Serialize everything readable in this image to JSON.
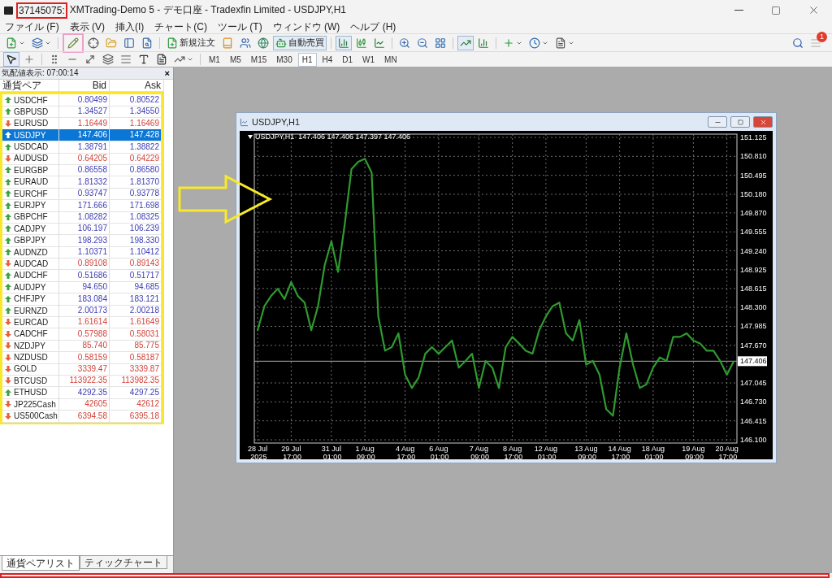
{
  "window": {
    "account": "37145075:",
    "title": "XMTrading-Demo 5 - デモ口座 - Tradexfin Limited - USDJPY,H1"
  },
  "menu": [
    "ファイル (F)",
    "表示 (V)",
    "挿入(I)",
    "チャート(C)",
    "ツール (T)",
    "ウィンドウ (W)",
    "ヘルプ (H)"
  ],
  "toolbar": {
    "order_button": "新規注文",
    "autotrade_button": "自動売買",
    "notification_count": "1"
  },
  "timeframes": [
    {
      "label": "M1",
      "selected": false
    },
    {
      "label": "M5",
      "selected": false
    },
    {
      "label": "M15",
      "selected": false
    },
    {
      "label": "M30",
      "selected": false
    },
    {
      "label": "H1",
      "selected": true
    },
    {
      "label": "H4",
      "selected": false
    },
    {
      "label": "D1",
      "selected": false
    },
    {
      "label": "W1",
      "selected": false
    },
    {
      "label": "MN",
      "selected": false
    }
  ],
  "market_watch": {
    "title": "気配値表示: 07:00:14",
    "close": "×",
    "columns": [
      "通貨ペア",
      "Bid",
      "Ask"
    ],
    "rows": [
      {
        "symbol": "USDCHF",
        "bid": "0.80499",
        "ask": "0.80522",
        "rising": true,
        "selected": false
      },
      {
        "symbol": "GBPUSD",
        "bid": "1.34527",
        "ask": "1.34550",
        "rising": true,
        "selected": false
      },
      {
        "symbol": "EURUSD",
        "bid": "1.16449",
        "ask": "1.16469",
        "rising": false,
        "selected": false
      },
      {
        "symbol": "USDJPY",
        "bid": "147.406",
        "ask": "147.428",
        "rising": true,
        "selected": true
      },
      {
        "symbol": "USDCAD",
        "bid": "1.38791",
        "ask": "1.38822",
        "rising": true,
        "selected": false
      },
      {
        "symbol": "AUDUSD",
        "bid": "0.64205",
        "ask": "0.64229",
        "rising": false,
        "selected": false
      },
      {
        "symbol": "EURGBP",
        "bid": "0.86558",
        "ask": "0.86580",
        "rising": true,
        "selected": false
      },
      {
        "symbol": "EURAUD",
        "bid": "1.81332",
        "ask": "1.81370",
        "rising": true,
        "selected": false
      },
      {
        "symbol": "EURCHF",
        "bid": "0.93747",
        "ask": "0.93778",
        "rising": true,
        "selected": false
      },
      {
        "symbol": "EURJPY",
        "bid": "171.666",
        "ask": "171.698",
        "rising": true,
        "selected": false
      },
      {
        "symbol": "GBPCHF",
        "bid": "1.08282",
        "ask": "1.08325",
        "rising": true,
        "selected": false
      },
      {
        "symbol": "CADJPY",
        "bid": "106.197",
        "ask": "106.239",
        "rising": true,
        "selected": false
      },
      {
        "symbol": "GBPJPY",
        "bid": "198.293",
        "ask": "198.330",
        "rising": true,
        "selected": false
      },
      {
        "symbol": "AUDNZD",
        "bid": "1.10371",
        "ask": "1.10412",
        "rising": true,
        "selected": false
      },
      {
        "symbol": "AUDCAD",
        "bid": "0.89108",
        "ask": "0.89143",
        "rising": false,
        "selected": false
      },
      {
        "symbol": "AUDCHF",
        "bid": "0.51686",
        "ask": "0.51717",
        "rising": true,
        "selected": false
      },
      {
        "symbol": "AUDJPY",
        "bid": "94.650",
        "ask": "94.685",
        "rising": true,
        "selected": false
      },
      {
        "symbol": "CHFJPY",
        "bid": "183.084",
        "ask": "183.121",
        "rising": true,
        "selected": false
      },
      {
        "symbol": "EURNZD",
        "bid": "2.00173",
        "ask": "2.00218",
        "rising": true,
        "selected": false
      },
      {
        "symbol": "EURCAD",
        "bid": "1.61614",
        "ask": "1.61649",
        "rising": false,
        "selected": false
      },
      {
        "symbol": "CADCHF",
        "bid": "0.57988",
        "ask": "0.58031",
        "rising": false,
        "selected": false
      },
      {
        "symbol": "NZDJPY",
        "bid": "85.740",
        "ask": "85.775",
        "rising": false,
        "selected": false
      },
      {
        "symbol": "NZDUSD",
        "bid": "0.58159",
        "ask": "0.58187",
        "rising": false,
        "selected": false
      },
      {
        "symbol": "GOLD",
        "bid": "3339.47",
        "ask": "3339.87",
        "rising": false,
        "selected": false
      },
      {
        "symbol": "BTCUSD",
        "bid": "113922.35",
        "ask": "113982.35",
        "rising": false,
        "selected": false
      },
      {
        "symbol": "ETHUSD",
        "bid": "4292.35",
        "ask": "4297.25",
        "rising": true,
        "selected": false
      },
      {
        "symbol": "JP225Cash",
        "bid": "42605",
        "ask": "42612",
        "rising": false,
        "selected": false
      },
      {
        "symbol": "US500Cash",
        "bid": "6394.58",
        "ask": "6395.18",
        "rising": false,
        "selected": false
      }
    ],
    "tabs": [
      {
        "label": "通貨ペアリスト",
        "selected": true
      },
      {
        "label": "ティックチャート",
        "selected": false
      }
    ]
  },
  "chart_window": {
    "title": "USDJPY,H1",
    "info": "USDJPY,H1  147.406 147.406 147.397 147.406",
    "chart_data": {
      "type": "line",
      "grid": true,
      "ref_lines": [
        {
          "axis": "y",
          "value": 147.406,
          "label": "147.406"
        }
      ],
      "categories": [
        "28 Jul 2025",
        null,
        null,
        null,
        null,
        "29 Jul 17:00",
        null,
        null,
        null,
        null,
        null,
        "31 Jul 01:00",
        null,
        null,
        null,
        null,
        "1 Aug 09:00",
        null,
        null,
        null,
        null,
        null,
        "4 Aug 17:00",
        null,
        null,
        null,
        null,
        "6 Aug 01:00",
        null,
        null,
        null,
        null,
        null,
        "7 Aug 09:00",
        null,
        null,
        null,
        null,
        "8 Aug 17:00",
        null,
        null,
        null,
        null,
        "12 Aug 01:00",
        null,
        null,
        null,
        null,
        null,
        "13 Aug 09:00",
        null,
        null,
        null,
        null,
        "14 Aug 17:00",
        null,
        null,
        null,
        null,
        "18 Aug 01:00",
        null,
        null,
        null,
        null,
        null,
        "19 Aug 09:00",
        null,
        null,
        null,
        null,
        "20 Aug 17:00",
        null
      ],
      "series": [
        {
          "color": "#2f9a2f",
          "values": [
            147.92,
            148.32,
            148.49,
            148.61,
            148.44,
            148.72,
            148.49,
            148.38,
            147.92,
            148.32,
            149.0,
            149.4,
            148.89,
            149.69,
            150.6,
            150.72,
            150.77,
            150.54,
            148.15,
            147.58,
            147.64,
            147.87,
            147.18,
            146.96,
            147.13,
            147.53,
            147.64,
            147.53,
            147.64,
            147.75,
            147.3,
            147.41,
            147.53,
            146.96,
            147.41,
            147.3,
            146.96,
            147.64,
            147.81,
            147.7,
            147.58,
            147.53,
            147.92,
            148.15,
            148.32,
            148.38,
            147.87,
            147.75,
            148.09,
            147.35,
            147.41,
            147.18,
            146.61,
            146.5,
            147.3,
            147.87,
            147.35,
            146.96,
            147.02,
            147.3,
            147.47,
            147.41,
            147.81,
            147.81,
            147.87,
            147.75,
            147.7,
            147.58,
            147.58,
            147.41,
            147.18,
            147.4
          ]
        }
      ],
      "ylim": [
        146.1,
        151.125
      ],
      "yticks": [
        {
          "value": 151.125,
          "label": "151.125"
        },
        {
          "value": 150.81,
          "label": "150.810"
        },
        {
          "value": 150.495,
          "label": "150.495"
        },
        {
          "value": 150.18,
          "label": "150.180"
        },
        {
          "value": 149.87,
          "label": "149.870"
        },
        {
          "value": 149.555,
          "label": "149.555"
        },
        {
          "value": 149.24,
          "label": "149.240"
        },
        {
          "value": 148.925,
          "label": "148.925"
        },
        {
          "value": 148.615,
          "label": "148.615"
        },
        {
          "value": 148.3,
          "label": "148.300"
        },
        {
          "value": 147.985,
          "label": "147.985"
        },
        {
          "value": 147.67,
          "label": "147.670"
        },
        {
          "value": 147.045,
          "label": "147.045"
        },
        {
          "value": 146.73,
          "label": "146.730"
        },
        {
          "value": 146.415,
          "label": "146.415"
        },
        {
          "value": 146.1,
          "label": "146.100"
        }
      ]
    }
  }
}
